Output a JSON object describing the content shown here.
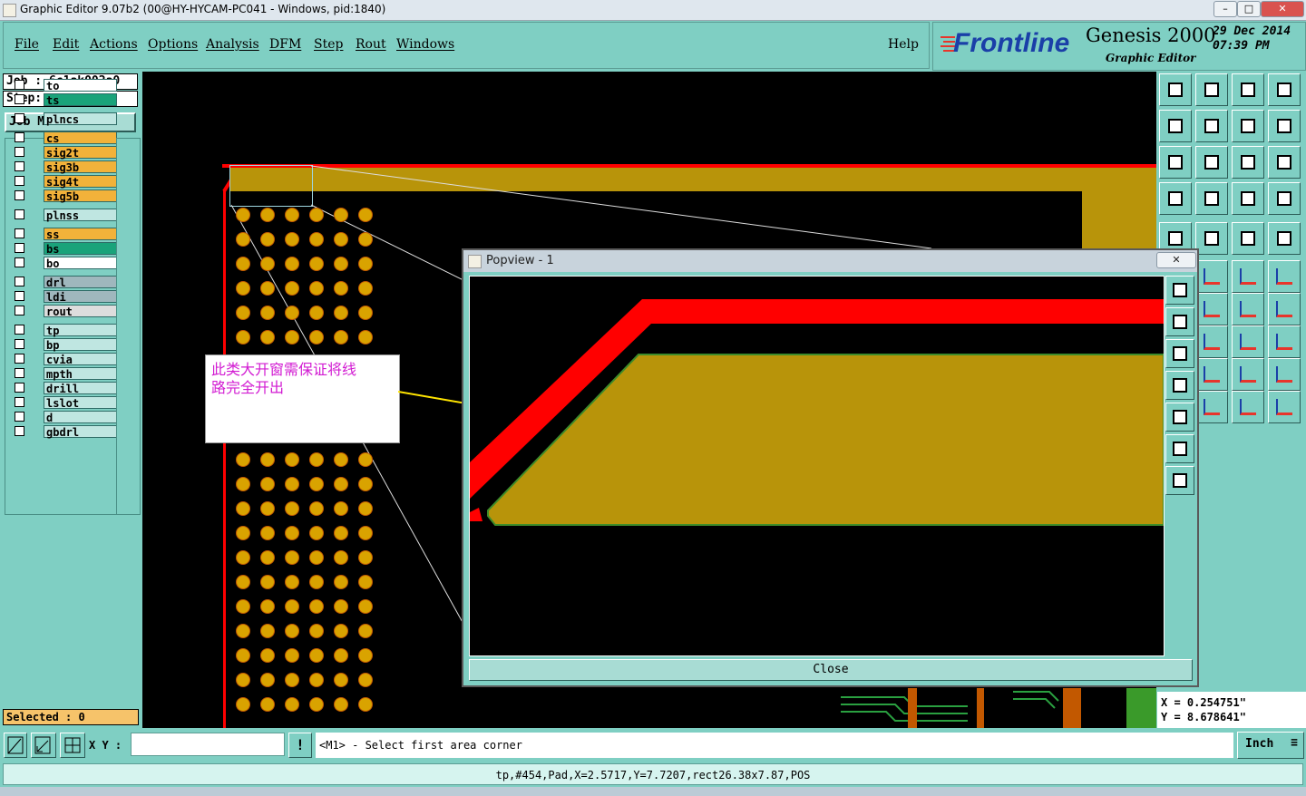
{
  "window": {
    "title": "Graphic Editor 9.07b2 (00@HY-HYCAM-PC041 - Windows, pid:1840)"
  },
  "menu": [
    "File",
    "Edit",
    "Actions",
    "Options",
    "Analysis",
    "DFM",
    "Step",
    "Rout",
    "Windows"
  ],
  "help": "Help",
  "brand": {
    "logo": "Frontline",
    "product": "Genesis 2000",
    "subtitle": "Graphic Editor",
    "date": "29 Dec 2014",
    "time": "07:39 PM"
  },
  "job": {
    "job_line": "Job : 6c1ak002a0",
    "step_line": "Step: cam",
    "matrix_button": "Job Matrix ..."
  },
  "layers": [
    {
      "name": "to",
      "color": "#ffffff"
    },
    {
      "name": "ts",
      "color": "#1aa37a"
    },
    {
      "name": "plncs",
      "color": "#bfe6e1"
    },
    {
      "name": "cs",
      "color": "#f2b23a"
    },
    {
      "name": "sig2t",
      "color": "#f2b23a"
    },
    {
      "name": "sig3b",
      "color": "#f2b23a"
    },
    {
      "name": "sig4t",
      "color": "#f2b23a"
    },
    {
      "name": "sig5b",
      "color": "#f2b23a"
    },
    {
      "name": "plnss",
      "color": "#bfe6e1"
    },
    {
      "name": "ss",
      "color": "#f2b23a"
    },
    {
      "name": "bs",
      "color": "#1aa37a"
    },
    {
      "name": "bo",
      "color": "#ffffff"
    },
    {
      "name": "drl",
      "color": "#9fb7bd"
    },
    {
      "name": "ldi",
      "color": "#9fb7bd"
    },
    {
      "name": "rout",
      "color": "#dddddd"
    },
    {
      "name": "tp",
      "color": "#bfe6e1"
    },
    {
      "name": "bp",
      "color": "#bfe6e1"
    },
    {
      "name": "cvia",
      "color": "#bfe6e1"
    },
    {
      "name": "mpth",
      "color": "#bfe6e1"
    },
    {
      "name": "drill",
      "color": "#bfe6e1"
    },
    {
      "name": "lslot",
      "color": "#bfe6e1"
    },
    {
      "name": "d",
      "color": "#bfe6e1"
    },
    {
      "name": "gbdrl",
      "color": "#bfe6e1"
    }
  ],
  "selected": "Selected : 0",
  "annotation": {
    "line1": "此类大开窗需保证将线",
    "line2": "路完全开出"
  },
  "popview": {
    "title": "Popview - 1",
    "close_label": "Close"
  },
  "coords": {
    "x": "X = 0.254751\"",
    "y": "Y = 8.678641\""
  },
  "command": {
    "xy_label": "X Y :",
    "xy_value": "",
    "exclaim": "!",
    "prompt": "<M1> - Select first area corner",
    "unit": "Inch"
  },
  "status": "tp,#454,Pad,X=2.5717,Y=7.7207,rect26.38x7.87,POS",
  "colors": {
    "panel": "#7fcfc3",
    "copper": "#b8940a",
    "mask": "#ff0000",
    "pad": "#d9a300"
  }
}
